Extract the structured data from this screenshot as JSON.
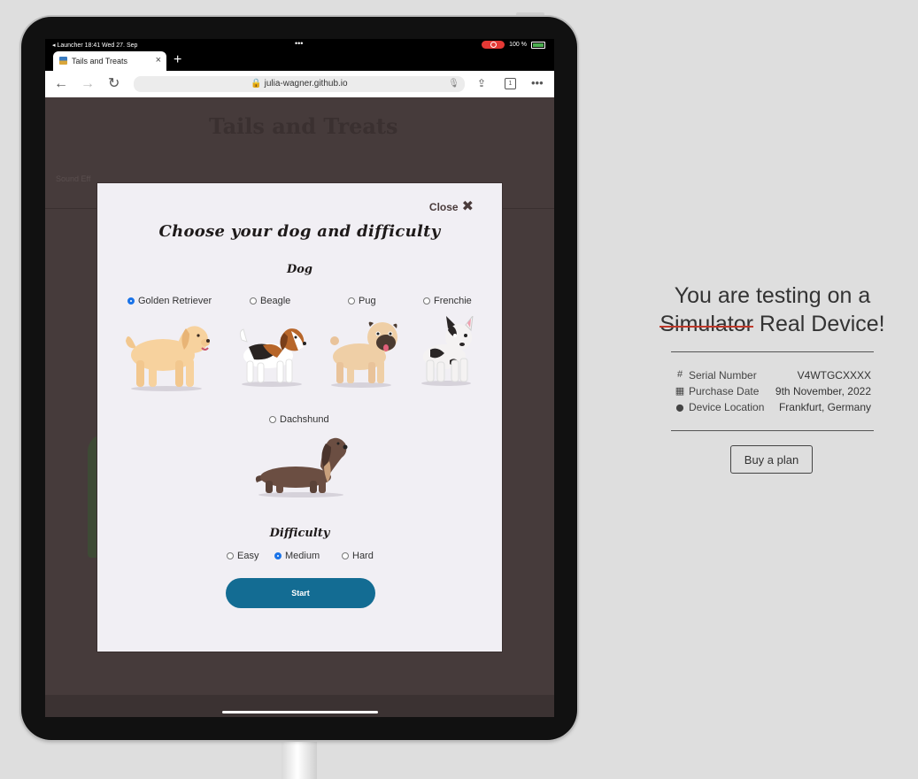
{
  "status_bar": {
    "left": "◂ Launcher  18:41  Wed 27. Sep",
    "center": "•••",
    "battery": "100 %"
  },
  "browser": {
    "tab_title": "Tails and Treats",
    "new_tab": "+",
    "tab_close": "×",
    "url": "🔒 julia-wagner.github.io",
    "tab_count": "1",
    "icons": [
      "back-icon",
      "forward-icon",
      "reload-icon",
      "mic-icon",
      "share-icon",
      "tabs-icon",
      "more-icon"
    ]
  },
  "background_page": {
    "title": "Tails and Treats",
    "sound_label": "Sound Eff"
  },
  "modal": {
    "close_label": "Close",
    "close_glyph": "✖",
    "title": "Choose your dog and difficulty",
    "dog_heading": "Dog",
    "dogs": [
      {
        "label": "Golden Retriever",
        "selected": true
      },
      {
        "label": "Beagle",
        "selected": false
      },
      {
        "label": "Pug",
        "selected": false
      },
      {
        "label": "Frenchie",
        "selected": false
      },
      {
        "label": "Dachshund",
        "selected": false
      }
    ],
    "difficulty_heading": "Difficulty",
    "difficulties": [
      {
        "label": "Easy",
        "selected": false
      },
      {
        "label": "Medium",
        "selected": true
      },
      {
        "label": "Hard",
        "selected": false
      }
    ],
    "start_label": "Start"
  },
  "info_panel": {
    "heading_line1": "You are testing on a",
    "struck_word": "Simulator",
    "heading_rest": "Real Device!",
    "rows": [
      {
        "icon": "hash-icon",
        "glyph": "#",
        "label": "Serial Number",
        "value": "V4WTGCXXXX"
      },
      {
        "icon": "calendar-icon",
        "glyph": "▦",
        "label": "Purchase Date",
        "value": "9th November, 2022"
      },
      {
        "icon": "location-pin-icon",
        "glyph": "⬤",
        "label": "Device Location",
        "value": "Frankfurt, Germany"
      }
    ],
    "buy_label": "Buy a plan"
  },
  "colors": {
    "accent": "#136c93",
    "radio_selected": "#1a73e8",
    "strike": "#c0392b",
    "overlay": "#463b3b"
  }
}
